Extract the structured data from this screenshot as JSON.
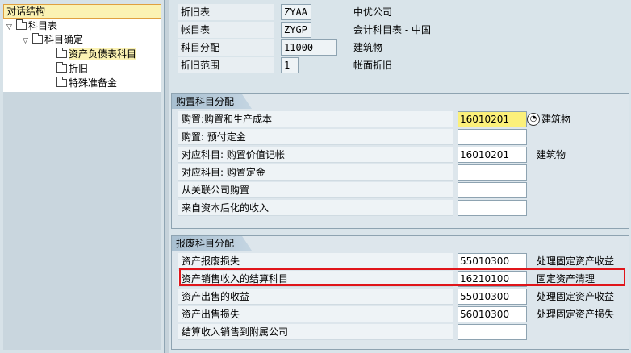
{
  "tree": {
    "title": "对话结构",
    "nodes": [
      {
        "label": "科目表",
        "indent": 0,
        "expanded": true,
        "selected": false
      },
      {
        "label": "科目确定",
        "indent": 1,
        "expanded": true,
        "selected": false
      },
      {
        "label": "资产负债表科目",
        "indent": 3,
        "expanded": null,
        "selected": true
      },
      {
        "label": "折旧",
        "indent": 3,
        "expanded": null,
        "selected": false
      },
      {
        "label": "特殊准备金",
        "indent": 3,
        "expanded": null,
        "selected": false
      }
    ]
  },
  "header": [
    {
      "label": "折旧表",
      "value": "ZYAA",
      "desc": "中优公司"
    },
    {
      "label": "帐目表",
      "value": "ZYGP",
      "desc": "会计科目表 - 中国"
    },
    {
      "label": "科目分配",
      "value": "11000",
      "desc": "建筑物"
    },
    {
      "label": "折旧范围",
      "value": "1",
      "desc": "帐面折旧"
    }
  ],
  "acquisition": {
    "title": "购置科目分配",
    "rows": [
      {
        "label": "购置:购置和生产成本",
        "value": "16010201",
        "desc": "建筑物",
        "focused": true
      },
      {
        "label": "购置: 预付定金",
        "value": "",
        "desc": ""
      },
      {
        "label": "对应科目: 购置价值记帐",
        "value": "16010201",
        "desc": "建筑物"
      },
      {
        "label": "对应科目: 购置定金",
        "value": "",
        "desc": ""
      },
      {
        "label": "从关联公司购置",
        "value": "",
        "desc": ""
      },
      {
        "label": "来自资本后化的收入",
        "value": "",
        "desc": ""
      }
    ]
  },
  "retirement": {
    "title": "报废科目分配",
    "rows": [
      {
        "label": "资产报废损失",
        "value": "55010300",
        "desc": "处理固定资产收益"
      },
      {
        "label": "资产销售收入的结算科目",
        "value": "16210100",
        "desc": "固定资产清理"
      },
      {
        "label": "资产出售的收益",
        "value": "55010300",
        "desc": "处理固定资产收益"
      },
      {
        "label": "资产出售损失",
        "value": "56010300",
        "desc": "处理固定资产损失"
      },
      {
        "label": "结算收入销售到附属公司",
        "value": "",
        "desc": ""
      }
    ]
  },
  "colors": {
    "highlight": "#e0151a",
    "focus_field": "#fbf07a",
    "tree_selection": "#fbf2b3"
  }
}
